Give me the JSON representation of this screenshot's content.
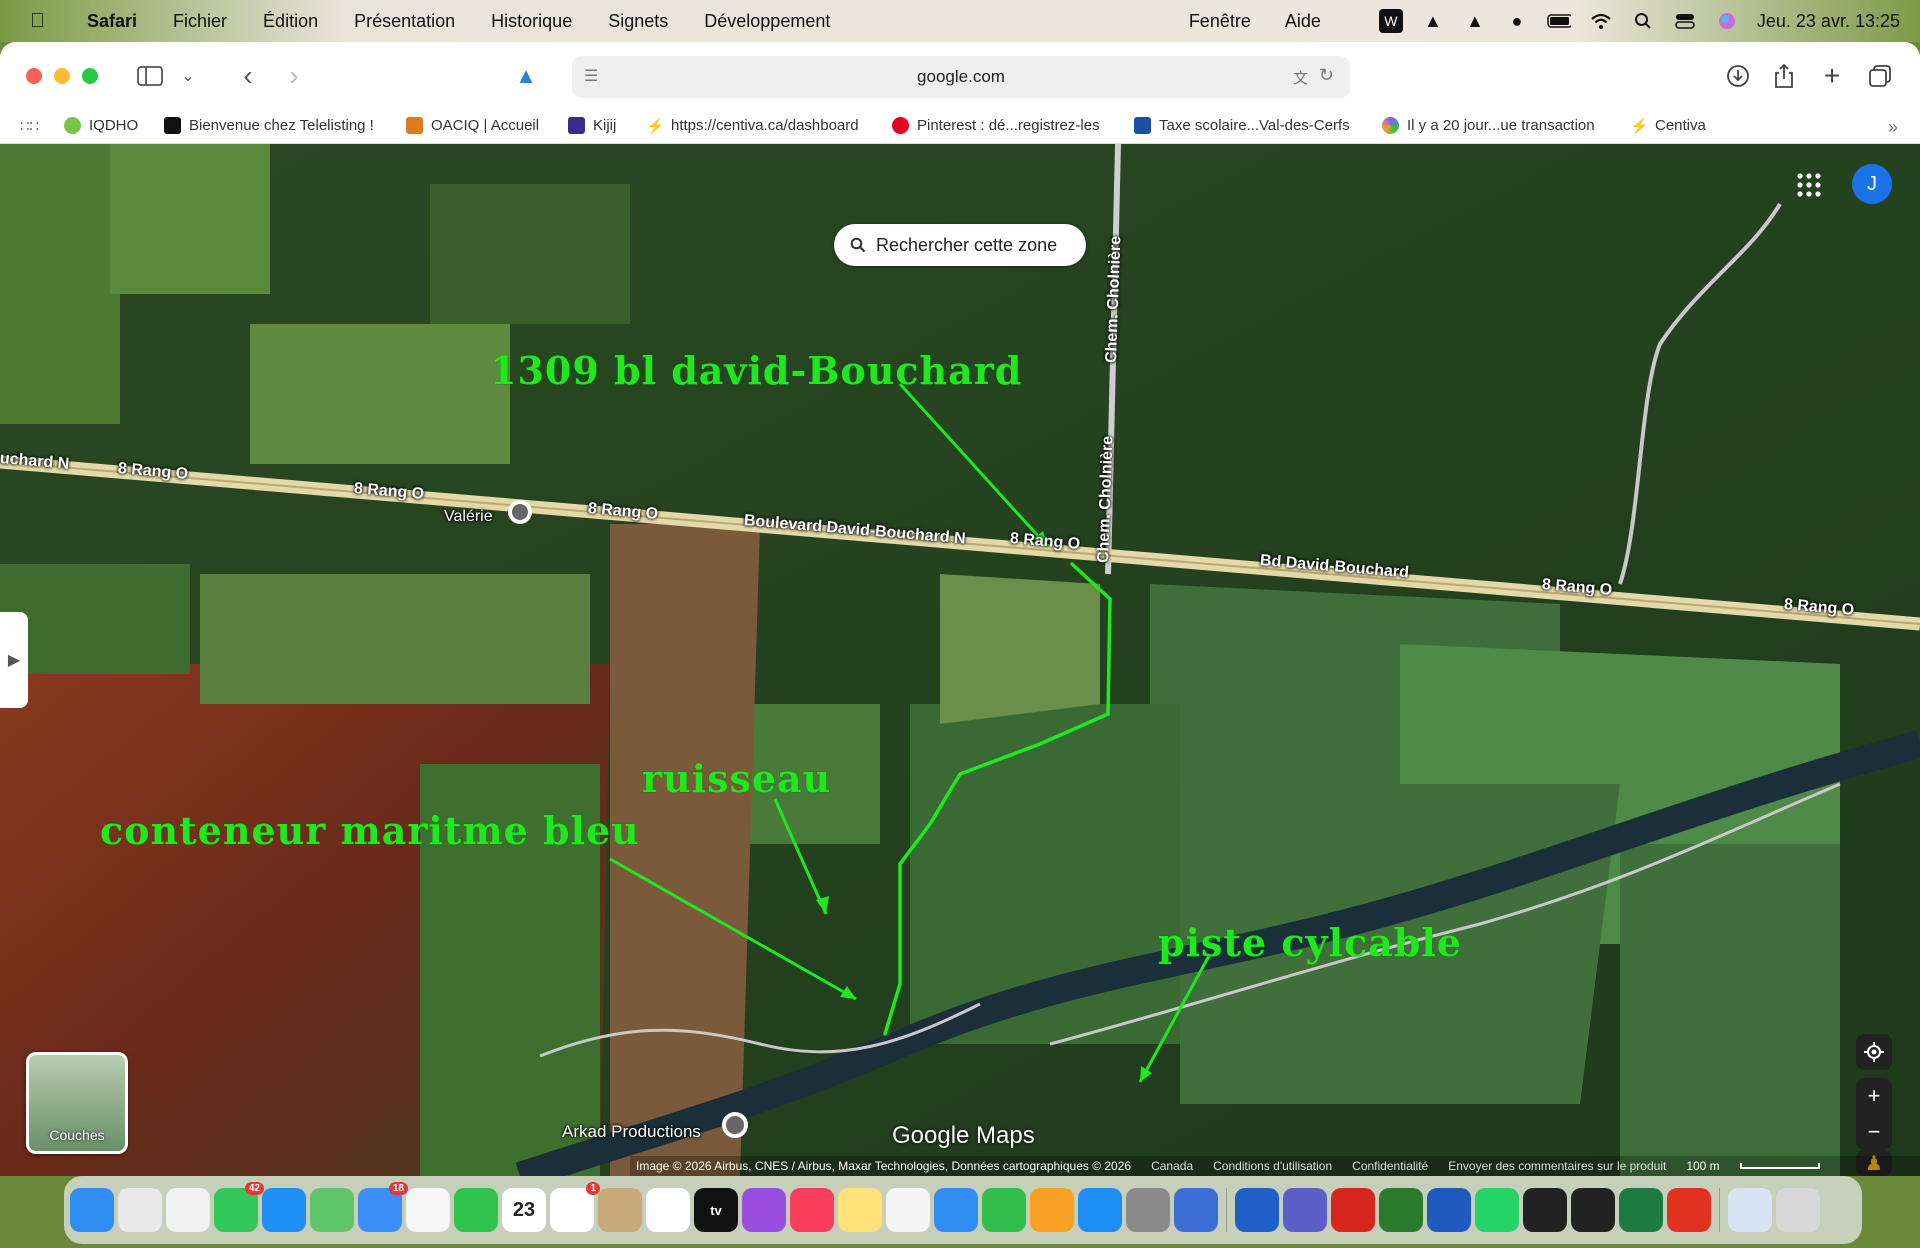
{
  "menubar": {
    "app": "Safari",
    "items": [
      "Fichier",
      "Édition",
      "Présentation",
      "Historique",
      "Signets",
      "Développement"
    ],
    "right_items": [
      "Fenêtre",
      "Aide"
    ],
    "clock": "Jeu. 23 avr. 13:25"
  },
  "toolbar": {
    "url": "google.com"
  },
  "bookmarks": [
    {
      "label": "IQDHO",
      "color": "#7cc24a"
    },
    {
      "label": "Bienvenue chez Telelisting !",
      "color": "#111111"
    },
    {
      "label": "OACIQ | Accueil",
      "color": "#e07a1f"
    },
    {
      "label": "Kijij",
      "color": "#3a2b8c"
    },
    {
      "label": "https://centiva.ca/dashboard",
      "color": "#2a7be4"
    },
    {
      "label": "Pinterest : dé...registrez-les",
      "color": "#e60023"
    },
    {
      "label": "Taxe scolaire...Val-des-Cerfs",
      "color": "#1b4fa0"
    },
    {
      "label": "Il y a 20 jour...ue transaction",
      "color": "#8a5cf6"
    },
    {
      "label": "Centiva",
      "color": "#2a7be4"
    }
  ],
  "map": {
    "search_zone": "Rechercher cette zone",
    "avatar_initial": "J",
    "road_labels": [
      "uchard N",
      "8 Rang O",
      "8 Rang O",
      "8 Rang O",
      "Boulevard David-Bouchard N",
      "8 Rang O",
      "Bd David-Bouchard",
      "8 Rang O",
      "8 Rang O",
      "Chem. Cholnière",
      "Chem. Cholnière"
    ],
    "places": {
      "valerie": "Valérie",
      "arkad": "Arkad Productions"
    },
    "annotations": {
      "address": "1309 bl david-Bouchard",
      "ruisseau": "ruisseau",
      "conteneur": "conteneur maritme bleu",
      "piste": "piste cylcable"
    },
    "layers_label": "Couches",
    "logo": "Google Maps",
    "attribution": {
      "imagery": "Image © 2026 Airbus, CNES / Airbus, Maxar Technologies, Données cartographiques © 2026",
      "country": "Canada",
      "terms": "Conditions d'utilisation",
      "privacy": "Confidentialité",
      "feedback": "Envoyer des commentaires sur le produit",
      "scale": "100 m"
    },
    "annotation_color": "#1fe81f"
  },
  "dock": {
    "apps": [
      {
        "name": "finder",
        "color": "#2f8ef0"
      },
      {
        "name": "launchpad",
        "color": "#e8e8e8"
      },
      {
        "name": "chrome",
        "color": "#f2f2f2"
      },
      {
        "name": "messages",
        "color": "#34c759",
        "badge": "42"
      },
      {
        "name": "safari",
        "color": "#1f8ff5"
      },
      {
        "name": "maps",
        "color": "#5fc46a"
      },
      {
        "name": "mail",
        "color": "#3a8ef5",
        "badge": "18"
      },
      {
        "name": "photos",
        "color": "#f7f7f7"
      },
      {
        "name": "facetime",
        "color": "#31c14d"
      },
      {
        "name": "calendar",
        "color": "#ffffff",
        "text": "23"
      },
      {
        "name": "reminders",
        "color": "#ffffff",
        "badge": "1"
      },
      {
        "name": "contacts",
        "color": "#c9a87a"
      },
      {
        "name": "freeform",
        "color": "#ffffff"
      },
      {
        "name": "tv",
        "color": "#111111",
        "text": "tv"
      },
      {
        "name": "podcasts",
        "color": "#9b4de0"
      },
      {
        "name": "music",
        "color": "#fa3d5a"
      },
      {
        "name": "notes",
        "color": "#ffe27a"
      },
      {
        "name": "news",
        "color": "#f5f5f5"
      },
      {
        "name": "keynote",
        "color": "#2f8ef0"
      },
      {
        "name": "numbers",
        "color": "#2fbf4a"
      },
      {
        "name": "pages",
        "color": "#f7a023"
      },
      {
        "name": "app-store",
        "color": "#1e8ef5"
      },
      {
        "name": "system-settings",
        "color": "#8a8a8a"
      },
      {
        "name": "iphone-mirroring",
        "color": "#3b6fd6"
      },
      {
        "name": "quicktime",
        "color": "#1e5fc8"
      },
      {
        "name": "teams",
        "color": "#5b5fc7"
      },
      {
        "name": "acrobat",
        "color": "#d7261e"
      },
      {
        "name": "sketch",
        "color": "#2c7a2c"
      },
      {
        "name": "word",
        "color": "#1f5bbf"
      },
      {
        "name": "whatsapp",
        "color": "#25d366"
      },
      {
        "name": "color-picker",
        "color": "#222222"
      },
      {
        "name": "activity-monitor",
        "color": "#222222"
      },
      {
        "name": "excel",
        "color": "#1d7a43"
      },
      {
        "name": "wps",
        "color": "#e0321f"
      },
      {
        "name": "downloads",
        "color": "#d8e4f3"
      },
      {
        "name": "trash",
        "color": "#d8d8d8"
      }
    ]
  }
}
